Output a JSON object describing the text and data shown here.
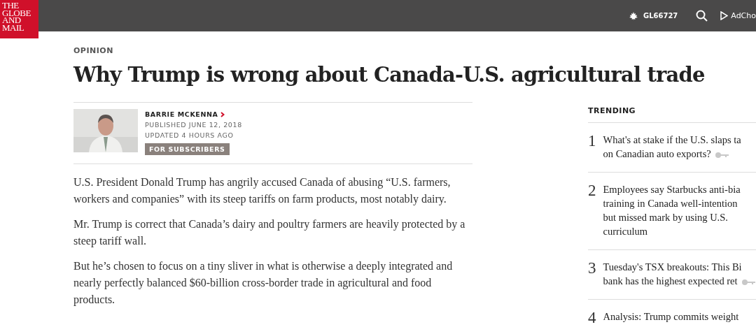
{
  "header": {
    "logo": [
      "THE",
      "GLOBE",
      "AND",
      "MAIL"
    ],
    "account": "GL66727",
    "adchoices": "AdCho"
  },
  "article": {
    "section": "OPINION",
    "title": "Why Trump is wrong about Canada-U.S. agricultural trade",
    "author": "BARRIE MCKENNA",
    "published": "PUBLISHED JUNE 12, 2018",
    "updated": "UPDATED 4 HOURS AGO",
    "badge": "FOR SUBSCRIBERS",
    "paragraphs": [
      "U.S. President Donald Trump has angrily accused Canada of abusing “U.S. farmers, workers and companies” with its steep tariffs on farm products, most notably dairy.",
      "Mr. Trump is correct that Canada’s dairy and poultry farmers are heavily protected by a steep tariff wall.",
      "But he’s chosen to focus on a tiny sliver in what is otherwise a deeply integrated and nearly perfectly balanced $60-billion cross-border trade in agricultural and food products."
    ]
  },
  "trending": {
    "heading": "TRENDING",
    "items": [
      {
        "number": "1",
        "lines": [
          "What's at stake if the U.S. slaps ta",
          "on Canadian auto exports?"
        ],
        "subscriber": true
      },
      {
        "number": "2",
        "lines": [
          "Employees say Starbucks anti-bia",
          "training in Canada well-intention",
          "but missed mark by using U.S.",
          "curriculum"
        ],
        "subscriber": false
      },
      {
        "number": "3",
        "lines": [
          "Tuesday's TSX breakouts: This Bi",
          "bank has the highest expected ret"
        ],
        "subscriber": true
      },
      {
        "number": "4",
        "lines": [
          "Analysis: Trump commits weight"
        ],
        "subscriber": false
      }
    ]
  }
}
